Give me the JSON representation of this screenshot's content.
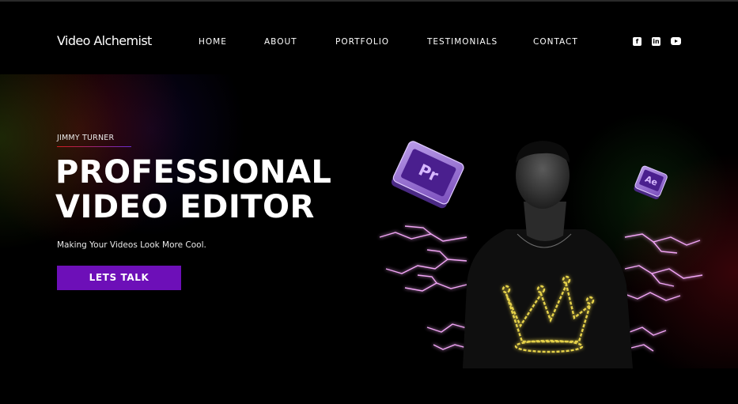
{
  "header": {
    "brand": "Video Alchemist",
    "nav": [
      "HOME",
      "ABOUT",
      "PORTFOLIO",
      "TESTIMONIALS",
      "CONTACT"
    ],
    "social": [
      {
        "icon": "facebook-icon",
        "glyph": "f"
      },
      {
        "icon": "linkedin-icon",
        "glyph": "in"
      },
      {
        "icon": "youtube-icon",
        "glyph": ""
      }
    ]
  },
  "hero": {
    "eyebrow": "JIMMY TURNER",
    "headline_line1": "PROFESSIONAL",
    "headline_line2": "VIDEO EDITOR",
    "tagline": "Making Your Videos Look More Cool.",
    "cta_label": "LETS TALK",
    "badges": {
      "premiere": "Pr",
      "after_effects": "Ae"
    }
  },
  "colors": {
    "accent": "#6d0fb8",
    "background": "#000000",
    "lightning": "#e98cf0",
    "crown": "#e6d24a"
  }
}
